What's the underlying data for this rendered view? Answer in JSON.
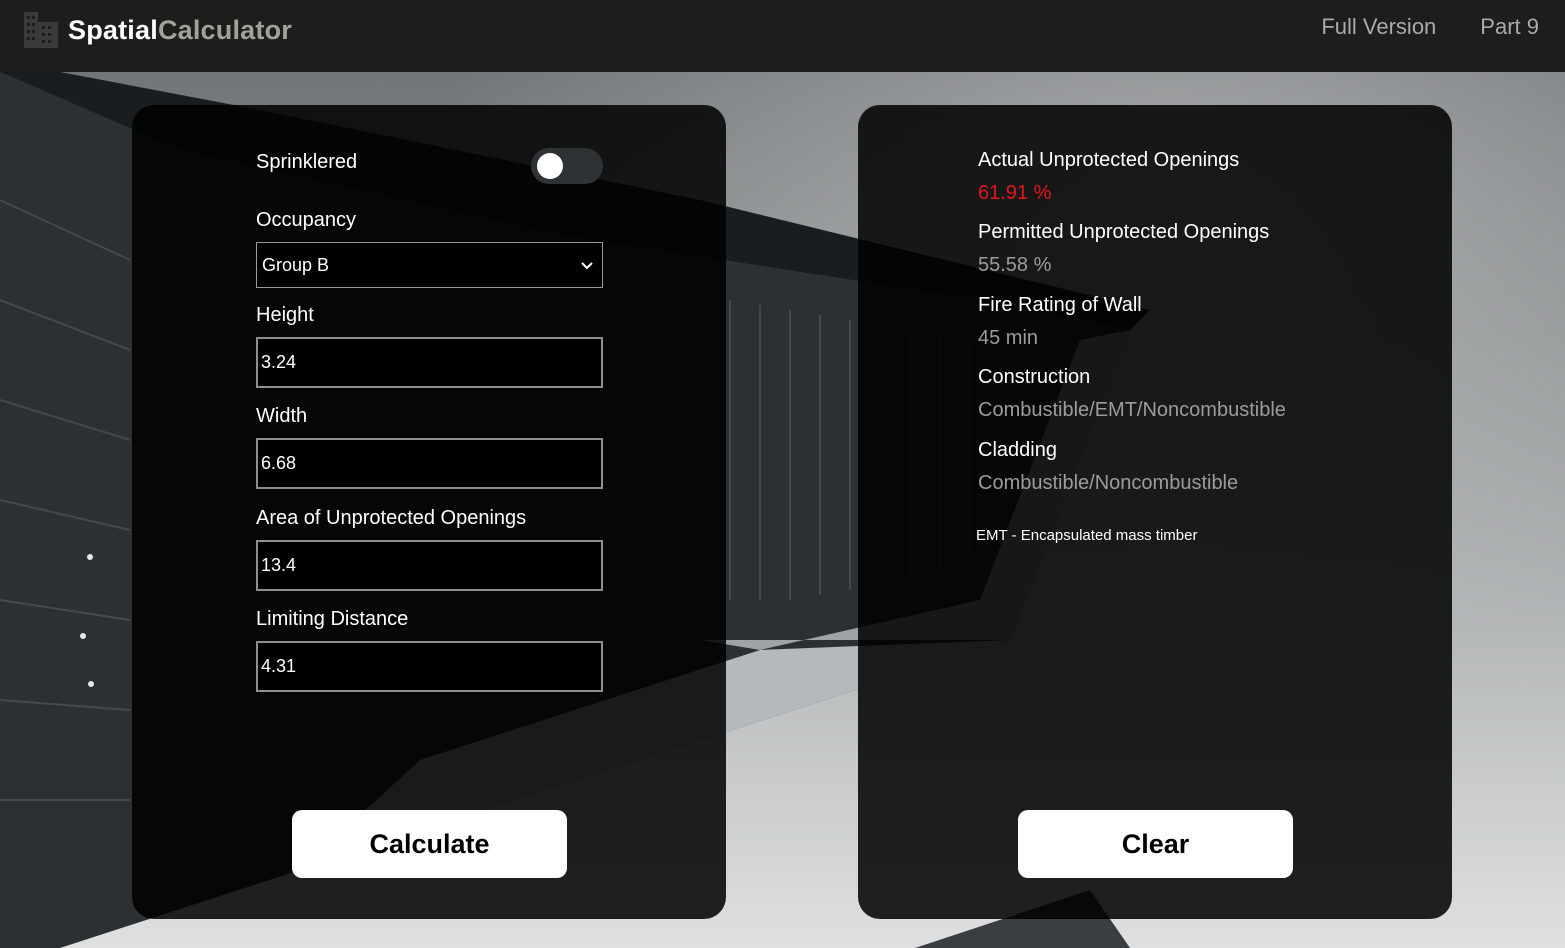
{
  "navbar": {
    "brand_primary": "Spatial",
    "brand_secondary": "Calculator",
    "brand_icon": "building-icon",
    "links": [
      "Full Version",
      "Part 9"
    ]
  },
  "form": {
    "sprinklered": {
      "label": "Sprinklered",
      "on": false
    },
    "occupancy": {
      "label": "Occupancy",
      "value": "Group B"
    },
    "height": {
      "label": "Height",
      "value": "3.24"
    },
    "width": {
      "label": "Width",
      "value": "6.68"
    },
    "area_unprotected": {
      "label": "Area of Unprotected Openings",
      "value": "13.4"
    },
    "limiting_distance": {
      "label": "Limiting Distance",
      "value": "4.31"
    },
    "calculate_label": "Calculate"
  },
  "results": {
    "items": [
      {
        "label": "Actual Unprotected Openings",
        "value": "61.91 %"
      },
      {
        "label": "Permitted Unprotected Openings",
        "value": "55.58 %"
      },
      {
        "label": "Fire Rating of Wall",
        "value": "45 min"
      },
      {
        "label": "Construction",
        "value": "Combustible/EMT/Noncombustible"
      },
      {
        "label": "Cladding",
        "value": "Combustible/Noncombustible"
      }
    ],
    "footnote": "EMT - Encapsulated mass timber",
    "clear_label": "Clear"
  },
  "colors": {
    "navbar_bg": "#1d1e1c",
    "brand_secondary": "#9fa39b",
    "alert_value": "#e8141b",
    "muted_value": "#9a9e98",
    "panel_bg": "rgba(0,0,0,0.86)"
  }
}
